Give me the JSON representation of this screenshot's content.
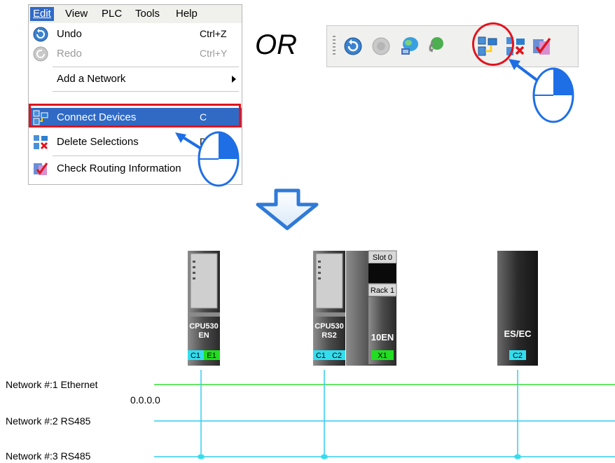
{
  "menubar": {
    "items": [
      "Edit",
      "View",
      "PLC",
      "Tools",
      "Help"
    ],
    "active": "Edit"
  },
  "edit_menu": {
    "items": [
      {
        "label": "Undo",
        "shortcut": "Ctrl+Z",
        "icon": "undo-icon",
        "enabled": true
      },
      {
        "label": "Redo",
        "shortcut": "Ctrl+Y",
        "icon": "redo-icon",
        "enabled": false
      },
      {
        "label": "Add a Network",
        "shortcut": "",
        "icon": "",
        "enabled": true,
        "submenu": true
      },
      {
        "label": "Connect Devices",
        "shortcut": "C",
        "icon": "connect-devices-icon",
        "enabled": true,
        "highlighted": true
      },
      {
        "label": "Delete Selections",
        "shortcut": "D",
        "icon": "delete-selections-icon",
        "enabled": true
      },
      {
        "label": "Check Routing Information",
        "shortcut": "",
        "icon": "check-routing-icon",
        "enabled": true
      }
    ]
  },
  "or_text": "OR",
  "toolbar": {
    "buttons": [
      "undo-icon",
      "redo-icon",
      "network-icon",
      "refresh-network-icon",
      "connect-devices-icon",
      "delete-selections-icon",
      "check-routing-icon"
    ],
    "highlighted": "connect-devices-icon"
  },
  "devices": [
    {
      "name_line1": "CPU530",
      "name_line2": "EN",
      "ports": [
        "C1",
        "E1"
      ]
    },
    {
      "name_line1": "CPU530",
      "name_line2": "RS2",
      "ports": [
        "C1",
        "C2"
      ]
    },
    {
      "slot": "Slot 0",
      "rack": "Rack 1",
      "name_line1": "10EN",
      "ports": [
        "X1"
      ]
    },
    {
      "name_line1": "ES/EC",
      "ports": [
        "C2"
      ]
    }
  ],
  "networks": [
    {
      "label": "Network #:1  Ethernet",
      "color": "#33dd33"
    },
    {
      "label": "Network #:2  RS485",
      "color": "#33ccee"
    },
    {
      "label": "Network #:3  RS485",
      "color": "#33ccee"
    }
  ],
  "ip_address": "0.0.0.0",
  "colors": {
    "menu_highlight": "#316ac5",
    "red_outline": "#e0141e",
    "pointer_blue": "#1e6ee6",
    "port_cyan": "#33ddee",
    "port_green": "#22dd22"
  }
}
